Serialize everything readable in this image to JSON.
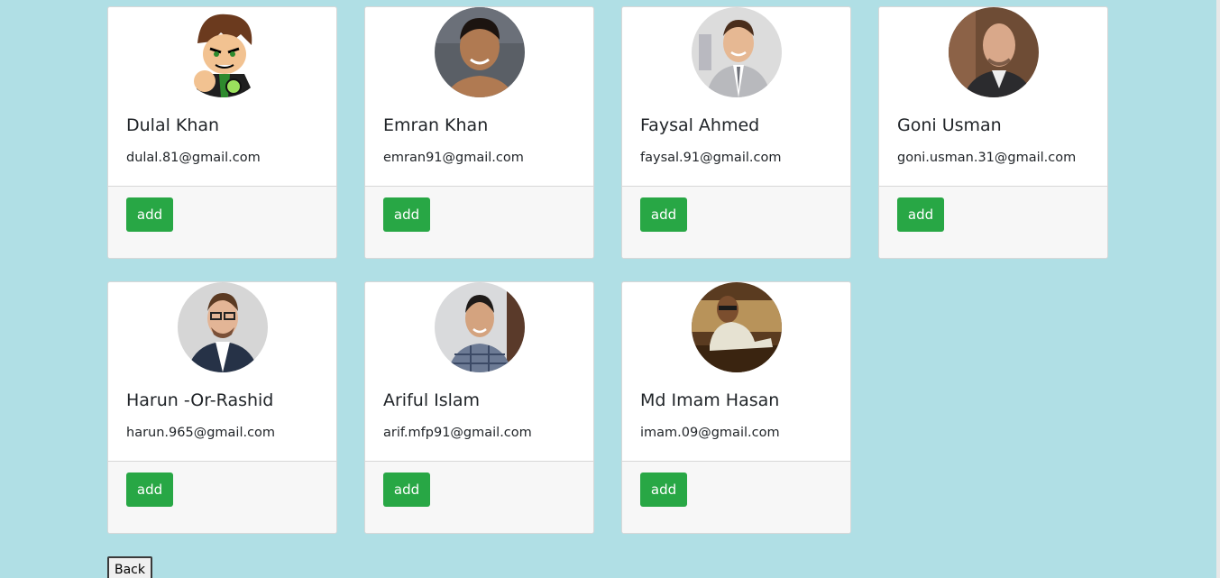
{
  "users": [
    {
      "name": "Dulal Khan",
      "email": "dulal.81@gmail.com",
      "button": "add",
      "avatar_icon": "cartoon-avatar-icon"
    },
    {
      "name": "Emran Khan",
      "email": "emran91@gmail.com",
      "button": "add",
      "avatar_icon": "user-photo-icon"
    },
    {
      "name": "Faysal Ahmed",
      "email": "faysal.91@gmail.com",
      "button": "add",
      "avatar_icon": "user-photo-icon"
    },
    {
      "name": "Goni Usman",
      "email": "goni.usman.31@gmail.com",
      "button": "add",
      "avatar_icon": "user-photo-icon"
    },
    {
      "name": "Harun -Or-Rashid",
      "email": "harun.965@gmail.com",
      "button": "add",
      "avatar_icon": "user-photo-icon"
    },
    {
      "name": "Ariful Islam",
      "email": "arif.mfp91@gmail.com",
      "button": "add",
      "avatar_icon": "user-photo-icon"
    },
    {
      "name": "Md Imam Hasan",
      "email": "imam.09@gmail.com",
      "button": "add",
      "avatar_icon": "user-photo-icon"
    }
  ],
  "back_button": "Back",
  "colors": {
    "background": "#b0dfe5",
    "add_button": "#28a745",
    "card_footer": "#f7f7f7"
  }
}
